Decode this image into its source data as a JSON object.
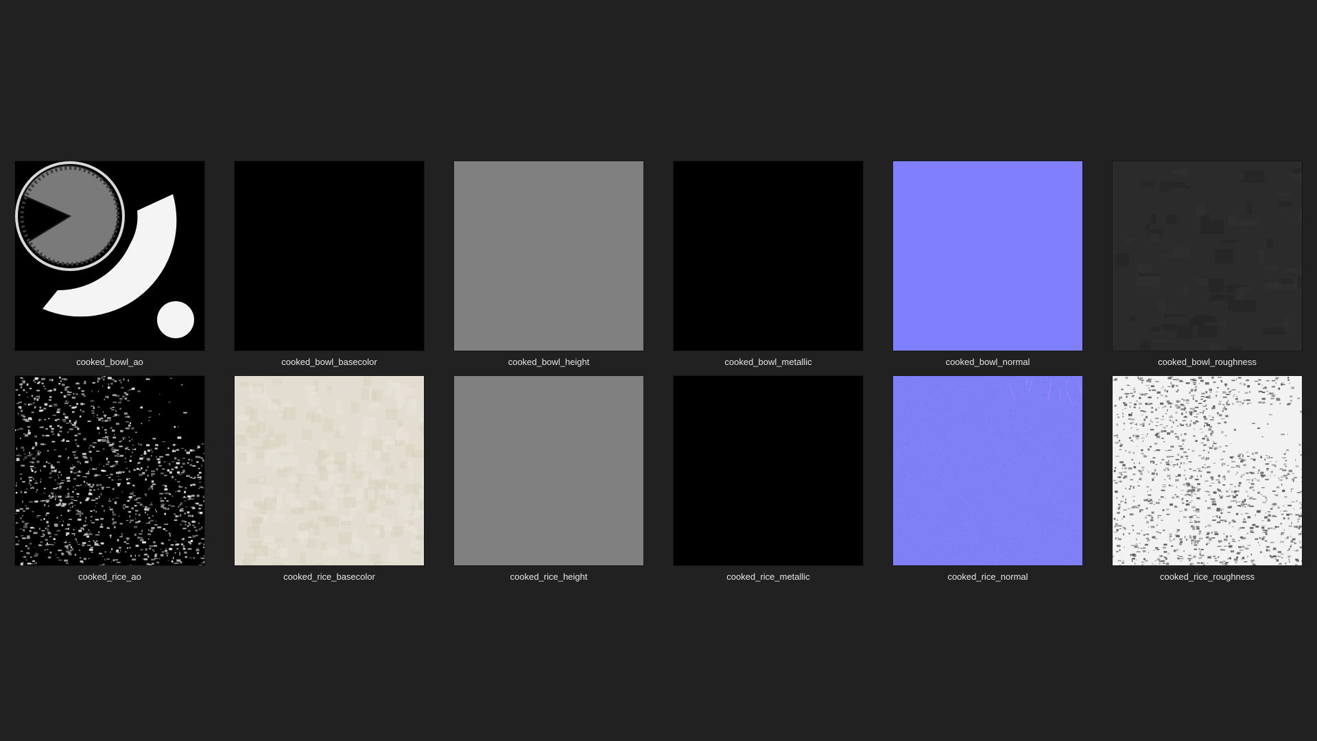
{
  "window": {
    "background": "#212121"
  },
  "textures": [
    {
      "name": "cooked_bowl_ao",
      "preview": "bowl-ao-map",
      "color": "#000000"
    },
    {
      "name": "cooked_bowl_basecolor",
      "preview": "solid",
      "color": "#000000"
    },
    {
      "name": "cooked_bowl_height",
      "preview": "solid",
      "color": "#808080"
    },
    {
      "name": "cooked_bowl_metallic",
      "preview": "solid",
      "color": "#000000"
    },
    {
      "name": "cooked_bowl_normal",
      "preview": "solid",
      "color": "#8080ff"
    },
    {
      "name": "cooked_bowl_roughness",
      "preview": "faint-noise",
      "color": "#2b2b2b"
    },
    {
      "name": "cooked_rice_ao",
      "preview": "speckle-dark",
      "color": "#000000"
    },
    {
      "name": "cooked_rice_basecolor",
      "preview": "grain-cream",
      "color": "#e2ddd0"
    },
    {
      "name": "cooked_rice_height",
      "preview": "solid",
      "color": "#808080"
    },
    {
      "name": "cooked_rice_metallic",
      "preview": "solid",
      "color": "#000000"
    },
    {
      "name": "cooked_rice_normal",
      "preview": "grain-blue",
      "color": "#7f80f6"
    },
    {
      "name": "cooked_rice_roughness",
      "preview": "speckle-light",
      "color": "#f2f2f2"
    }
  ]
}
